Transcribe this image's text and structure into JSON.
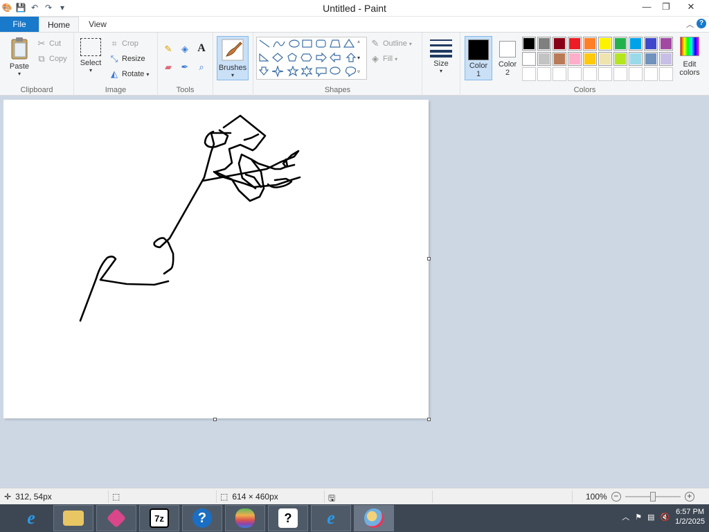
{
  "window": {
    "title": "Untitled - Paint"
  },
  "tabs": {
    "file": "File",
    "home": "Home",
    "view": "View"
  },
  "clipboard": {
    "paste": "Paste",
    "cut": "Cut",
    "copy": "Copy",
    "label": "Clipboard"
  },
  "image": {
    "select": "Select",
    "crop": "Crop",
    "resize": "Resize",
    "rotate": "Rotate",
    "label": "Image"
  },
  "tools": {
    "label": "Tools",
    "text_tool": "A"
  },
  "brushes": {
    "label": "Brushes"
  },
  "shapes": {
    "label": "Shapes",
    "outline": "Outline",
    "fill": "Fill"
  },
  "size": {
    "label": "Size"
  },
  "colors": {
    "color1_label": "Color",
    "color1_num": "1",
    "color2_label": "Color",
    "color2_num": "2",
    "color1": "#000000",
    "color2": "#ffffff",
    "edit_label_1": "Edit",
    "edit_label_2": "colors",
    "label": "Colors",
    "palette": [
      "#000000",
      "#7f7f7f",
      "#880015",
      "#ed1c24",
      "#ff7f27",
      "#fff200",
      "#22b14c",
      "#00a2e8",
      "#3f48cc",
      "#a349a4",
      "#ffffff",
      "#c3c3c3",
      "#b97a57",
      "#ffaec9",
      "#ffc90e",
      "#efe4b0",
      "#b5e61d",
      "#99d9ea",
      "#7092be",
      "#c8bfe7"
    ]
  },
  "status": {
    "cursor_pos": "312, 54px",
    "canvas_size": "614 × 460px",
    "zoom": "100%"
  },
  "taskbar": {
    "apps": [
      "internet-explorer",
      "file-explorer",
      "app-pink",
      "7zip",
      "help",
      "apple-app",
      "help-tips",
      "internet-explorer-2",
      "paint"
    ],
    "z7_text": "7z",
    "help_text": "?",
    "time": "6:57 PM",
    "date": "1/2/2025"
  }
}
